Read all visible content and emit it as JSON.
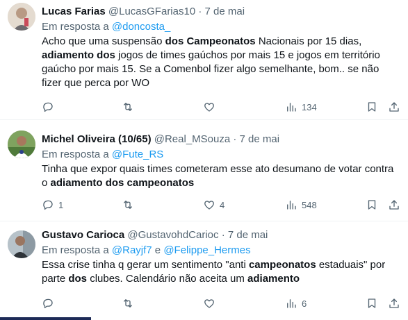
{
  "tweets": [
    {
      "name": "Lucas Farias",
      "handle": "@LucasGFarias10",
      "dot": "·",
      "date": "7 de mai",
      "reply_prefix": "Em resposta a ",
      "mentions": [
        "@doncosta_"
      ],
      "text_parts": [
        {
          "t": "Acho que uma suspensão ",
          "b": false
        },
        {
          "t": "dos Campeonatos",
          "b": true
        },
        {
          "t": " Nacionais por 15 dias, ",
          "b": false
        },
        {
          "t": "adiamento dos",
          "b": true
        },
        {
          "t": " jogos de times gaúchos por mais 15 e jogos em território gaúcho por mais 15. Se a Comenbol fizer algo semelhante, bom.. se não fizer que perca por WO",
          "b": false
        }
      ],
      "replies": "",
      "retweets": "",
      "likes": "",
      "views": "134"
    },
    {
      "name": "Michel Oliveira (10/65)",
      "handle": "@Real_MSouza",
      "dot": "·",
      "date": "7 de mai",
      "reply_prefix": "Em resposta a ",
      "mentions": [
        "@Fute_RS"
      ],
      "text_parts": [
        {
          "t": "Tinha que expor quais times cometeram esse ato desumano de votar contra o ",
          "b": false
        },
        {
          "t": "adiamento dos campeonatos",
          "b": true
        }
      ],
      "replies": "1",
      "retweets": "",
      "likes": "4",
      "views": "548"
    },
    {
      "name": "Gustavo Carioca",
      "handle": "@GustavohdCarioc",
      "dot": "·",
      "date": "7 de mai",
      "reply_prefix": "Em resposta a ",
      "mentions": [
        "@Rayjf7",
        "@Felippe_Hermes"
      ],
      "mention_joiner": " e ",
      "text_parts": [
        {
          "t": "Essa crise tinha q gerar um sentimento \"anti ",
          "b": false
        },
        {
          "t": "campeonatos",
          "b": true
        },
        {
          "t": " estaduais\" por parte ",
          "b": false
        },
        {
          "t": "dos",
          "b": true
        },
        {
          "t": " clubes. Calendário não aceita um ",
          "b": false
        },
        {
          "t": "adiamento",
          "b": true
        }
      ],
      "replies": "",
      "retweets": "",
      "likes": "",
      "views": "6"
    }
  ],
  "icons": {
    "reply": "reply-icon",
    "retweet": "retweet-icon",
    "like": "heart-icon",
    "views": "views-icon",
    "bookmark": "bookmark-icon",
    "share": "share-icon"
  },
  "colors": {
    "text": "#0f1419",
    "secondary": "#536471",
    "link": "#1d9bf0",
    "divider": "#eff3f4"
  }
}
